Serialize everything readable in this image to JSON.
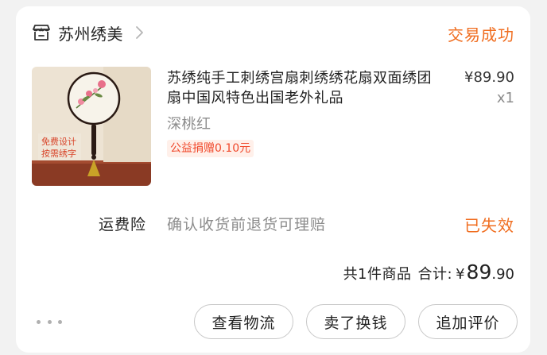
{
  "shop": {
    "name": "苏州绣美",
    "order_status": "交易成功"
  },
  "product": {
    "title": "苏绣纯手工刺绣宫扇刺绣绣花扇双面绣团扇中国风特色出国老外礼品",
    "variant": "深桃红",
    "charity_badge": "公益捐赠0.10元",
    "price": "¥89.90",
    "quantity": "x1",
    "image_text_line1": "免费设计",
    "image_text_line2": "按需绣字"
  },
  "insurance": {
    "label": "运费险",
    "description": "确认收货前退货可理赔",
    "status": "已失效"
  },
  "summary": {
    "count": "共1件商品",
    "total_label": "合计:",
    "currency": "¥",
    "total_int": "89",
    "total_dec": ".90"
  },
  "actions": {
    "logistics": "查看物流",
    "sell": "卖了换钱",
    "review": "追加评价"
  },
  "colors": {
    "accent_orange": "#f06d1f",
    "charity_red": "#f0482b"
  },
  "icons": {
    "shop": "store-icon",
    "chevron": "chevron-right-icon",
    "more": "more-dots-icon"
  }
}
